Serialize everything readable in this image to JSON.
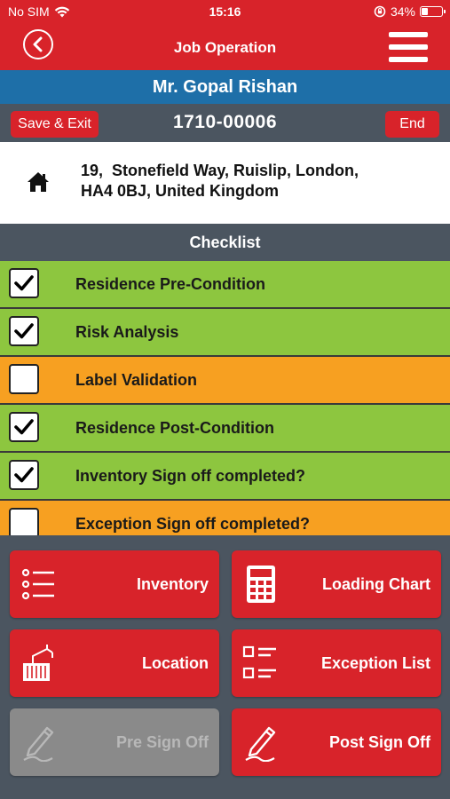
{
  "status_bar": {
    "carrier": "No SIM",
    "time": "15:16",
    "battery_percent": "34%",
    "battery_level": 0.34
  },
  "nav": {
    "title": "Job Operation",
    "back_icon": "chevron-left-circle-icon",
    "menu_icon": "hamburger-menu-icon"
  },
  "customer": {
    "name": "Mr. Gopal Rishan"
  },
  "job": {
    "save_exit_label": "Save & Exit",
    "number": "1710-00006",
    "end_label": "End"
  },
  "address": {
    "icon": "home-icon",
    "line1": "19,  Stonefield Way, Ruislip, London,",
    "line2": "HA4 0BJ, United Kingdom"
  },
  "checklist": {
    "title": "Checklist",
    "items": [
      {
        "label": "Residence Pre-Condition",
        "checked": true
      },
      {
        "label": "Risk Analysis",
        "checked": true
      },
      {
        "label": "Label Validation",
        "checked": false
      },
      {
        "label": "Residence Post-Condition",
        "checked": true
      },
      {
        "label": "Inventory Sign off completed?",
        "checked": true
      },
      {
        "label": "Exception Sign off completed?",
        "checked": false
      }
    ]
  },
  "colors": {
    "brand_red": "#d8232a",
    "done_green": "#8dc63f",
    "pending_orange": "#f7a021",
    "header_blue": "#1e6fa8",
    "slate": "#4b5560"
  },
  "actions": [
    {
      "label": "Inventory",
      "icon": "list-icon",
      "enabled": true
    },
    {
      "label": "Loading Chart",
      "icon": "calculator-icon",
      "enabled": true
    },
    {
      "label": "Location",
      "icon": "container-crane-icon",
      "enabled": true
    },
    {
      "label": "Exception List",
      "icon": "checklist-icon",
      "enabled": true
    },
    {
      "label": "Pre Sign Off",
      "icon": "pen-signature-icon",
      "enabled": false
    },
    {
      "label": "Post Sign Off",
      "icon": "pen-signature-icon",
      "enabled": true
    }
  ]
}
